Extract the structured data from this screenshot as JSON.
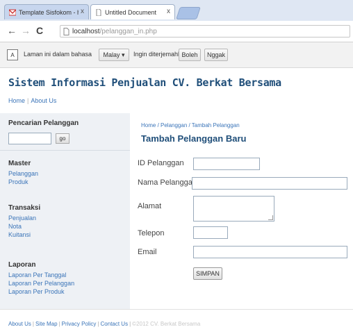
{
  "browser": {
    "tabs": [
      {
        "label": "Template Sisfokom - hamidel",
        "close": "x"
      },
      {
        "label": "Untitled Document",
        "close": "x"
      }
    ],
    "nav": {
      "back": "←",
      "forward": "→",
      "reload": "C"
    },
    "url": {
      "host": "localhost",
      "path": "/pelanggan_in.php"
    }
  },
  "translate_bar": {
    "icon": "A",
    "text": "Laman ini dalam bahasa",
    "language": "Malay ▾",
    "question": "Ingin diterjemahkan?",
    "yes": "Boleh",
    "no": "Nggak"
  },
  "site": {
    "title": "Sistem Informasi Penjualan CV. Berkat Bersama",
    "nav": {
      "home": "Home",
      "about": "About Us"
    }
  },
  "sidebar": {
    "search_heading": "Pencarian Pelanggan",
    "search_go": "go",
    "master_heading": "Master",
    "master_items": [
      "Pelanggan",
      "Produk"
    ],
    "transaksi_heading": "Transaksi",
    "transaksi_items": [
      "Penjualan",
      "Nota",
      "Kuitansi"
    ],
    "laporan_heading": "Laporan",
    "laporan_items": [
      "Laporan Per Tanggal",
      "Laporan Per Pelanggan",
      "Laporan Per Produk"
    ]
  },
  "main": {
    "breadcrumb": "Home / Pelanggan / Tambah Pelanggan",
    "title": "Tambah Pelanggan Baru",
    "labels": {
      "id": "ID Pelanggan",
      "nama": "Nama Pelanggan",
      "alamat": "Alamat",
      "telepon": "Telepon",
      "email": "Email"
    },
    "submit": "SIMPAN"
  },
  "footer": {
    "links": [
      "About Us",
      "Site Map",
      "Privacy Policy",
      "Contact Us"
    ],
    "copyright": "©2012 CV. Berkat Bersama"
  },
  "colors": {
    "title": "#1f4e79",
    "link": "#3a74b8",
    "sidebar_bg": "#eef1f5"
  }
}
